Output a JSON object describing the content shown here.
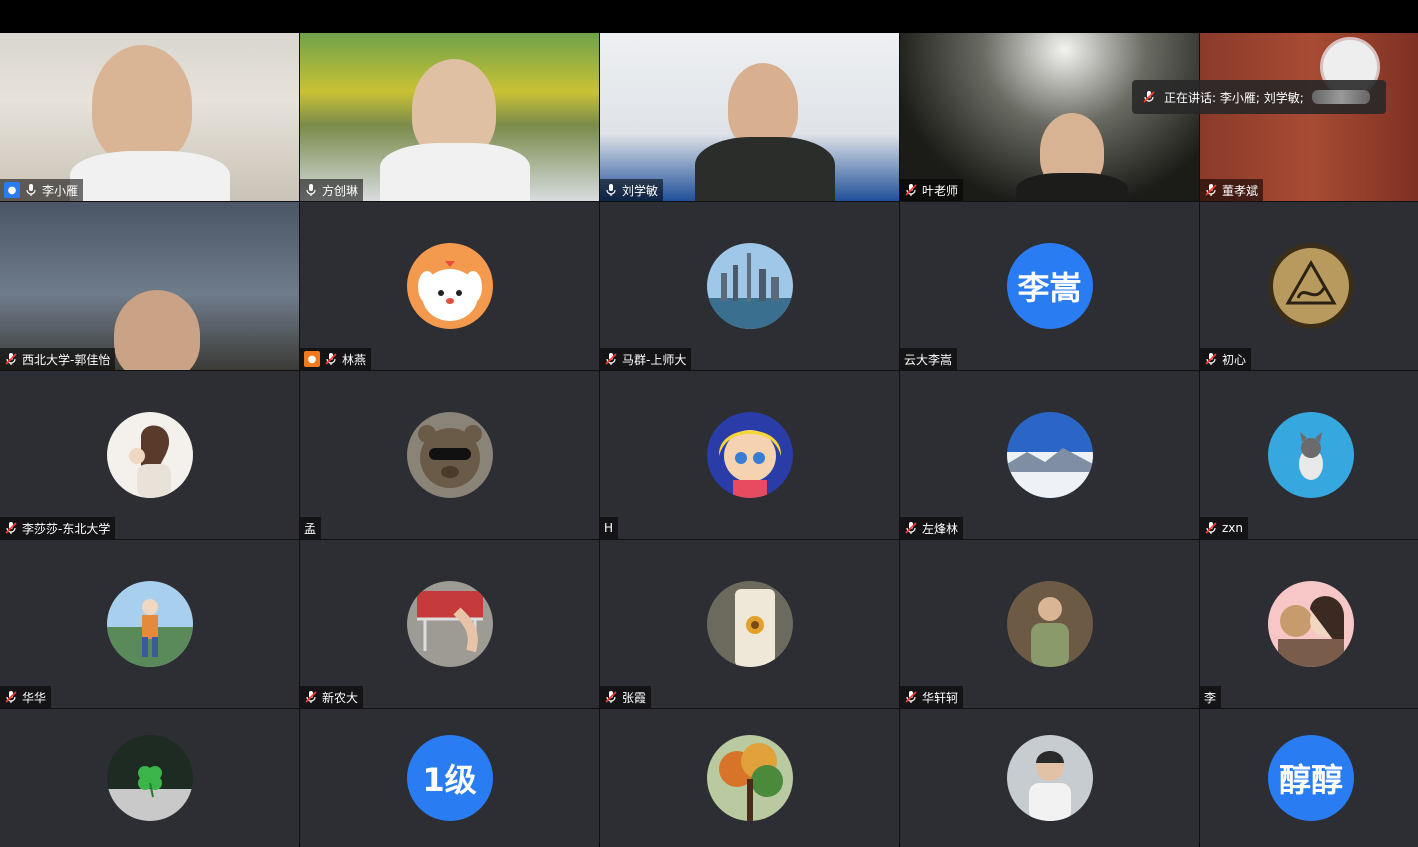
{
  "speaking": {
    "prefix": "正在讲话: 李小雁; 刘学敏;"
  },
  "tiles": [
    {
      "name": "李小雁",
      "mic": "on",
      "host": "blue",
      "type": "video",
      "v": "v1",
      "active": true
    },
    {
      "name": "方创琳",
      "mic": "on",
      "type": "video",
      "v": "v2"
    },
    {
      "name": "刘学敏",
      "mic": "on",
      "type": "video",
      "v": "v3"
    },
    {
      "name": "叶老师",
      "mic": "muted",
      "type": "video",
      "v": "v4"
    },
    {
      "name": "董孝斌",
      "mic": "muted",
      "type": "video",
      "v": "v5"
    },
    {
      "name": "西北大学-郭佳怡",
      "mic": "muted",
      "type": "video",
      "v": "v6"
    },
    {
      "name": "林燕",
      "mic": "muted",
      "host": "orange",
      "type": "avatar",
      "avatar": "puppy"
    },
    {
      "name": "马群-上师大",
      "mic": "muted",
      "type": "avatar",
      "avatar": "city"
    },
    {
      "name": "云大李嵩",
      "mic": "none",
      "type": "text",
      "initials": "李嵩"
    },
    {
      "name": "初心",
      "mic": "muted",
      "type": "avatar",
      "avatar": "sign"
    },
    {
      "name": "李莎莎-东北大学",
      "mic": "muted",
      "type": "avatar",
      "avatar": "girl"
    },
    {
      "name": "孟",
      "mic": "none",
      "type": "avatar",
      "avatar": "bear"
    },
    {
      "name": "H",
      "mic": "none",
      "type": "avatar",
      "avatar": "anime"
    },
    {
      "name": "左烽林",
      "mic": "muted",
      "type": "avatar",
      "avatar": "snow"
    },
    {
      "name": "zxn",
      "mic": "muted",
      "type": "avatar",
      "avatar": "cat"
    },
    {
      "name": "华华",
      "mic": "muted",
      "type": "avatar",
      "avatar": "hiker"
    },
    {
      "name": "新农大",
      "mic": "muted",
      "type": "avatar",
      "avatar": "cart"
    },
    {
      "name": "张霞",
      "mic": "muted",
      "type": "avatar",
      "avatar": "flower"
    },
    {
      "name": "华轩轲",
      "mic": "muted",
      "type": "avatar",
      "avatar": "man"
    },
    {
      "name": "李",
      "mic": "none",
      "type": "avatar",
      "avatar": "couple"
    },
    {
      "name": "",
      "mic": "none",
      "type": "avatar",
      "avatar": "clover"
    },
    {
      "name": "",
      "mic": "none",
      "type": "text",
      "initials": "1级"
    },
    {
      "name": "",
      "mic": "none",
      "type": "avatar",
      "avatar": "tree"
    },
    {
      "name": "",
      "mic": "none",
      "type": "avatar",
      "avatar": "portrait"
    },
    {
      "name": "",
      "mic": "none",
      "type": "text",
      "initials": "醇醇"
    }
  ]
}
